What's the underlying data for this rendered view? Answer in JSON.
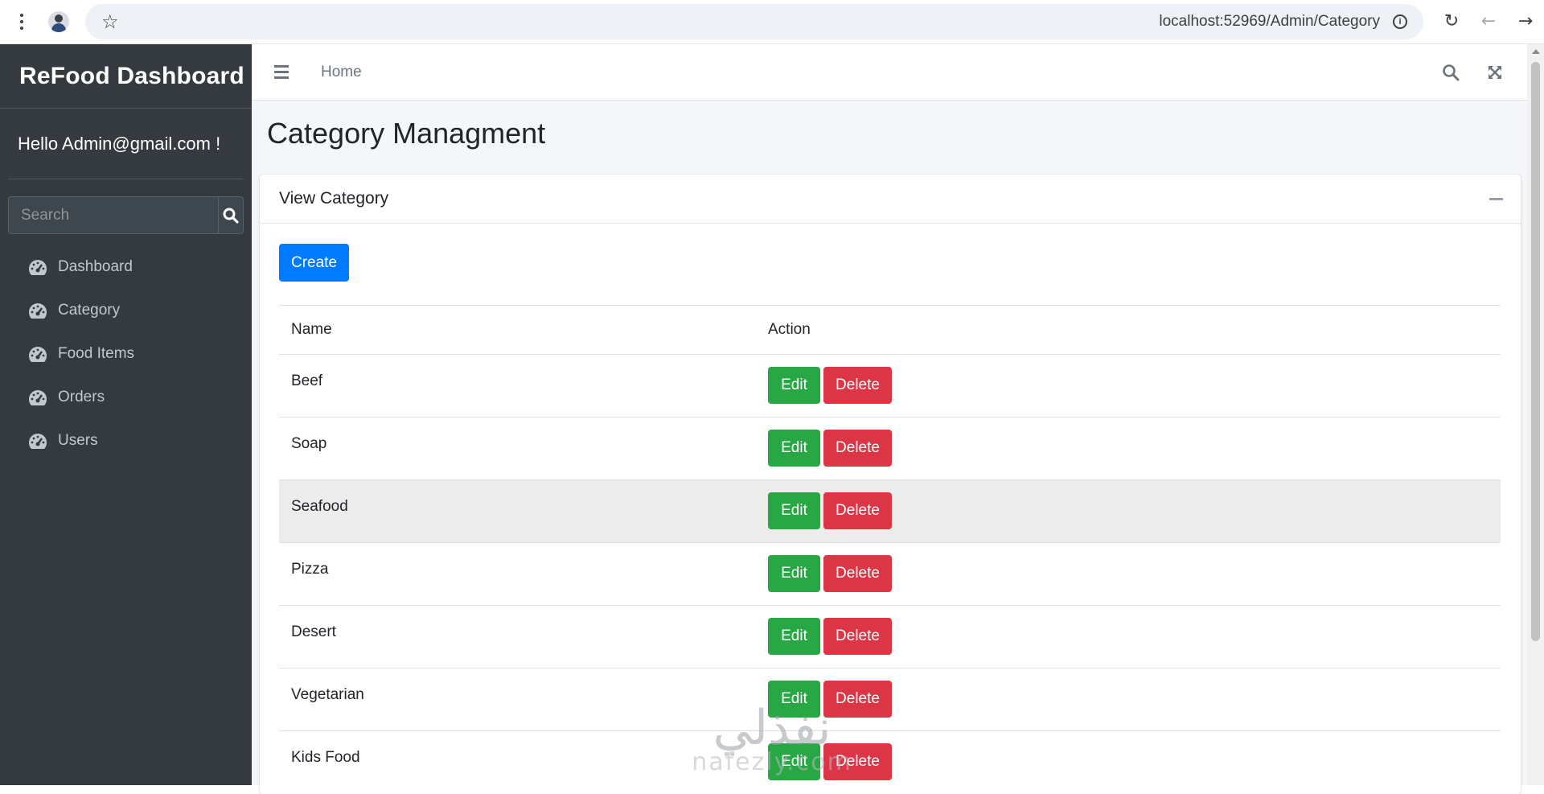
{
  "browser": {
    "url": "localhost:52969/Admin/Category",
    "icons": [
      "menu-kebab-icon",
      "profile-avatar",
      "bookmark-star-icon",
      "site-info-icon",
      "reload-icon",
      "back-arrow-icon",
      "forward-arrow-icon"
    ]
  },
  "sidebar": {
    "brand": "ReFood Dashboard",
    "greeting": "Hello Admin@gmail.com !",
    "search_placeholder": "Search",
    "items": [
      {
        "label": "Dashboard",
        "icon": "gauge-icon"
      },
      {
        "label": "Category",
        "icon": "gauge-icon"
      },
      {
        "label": "Food Items",
        "icon": "gauge-icon"
      },
      {
        "label": "Orders",
        "icon": "gauge-icon"
      },
      {
        "label": "Users",
        "icon": "gauge-icon"
      }
    ]
  },
  "topbar": {
    "home": "Home",
    "icons": [
      "hamburger-menu-icon",
      "search-icon",
      "fullscreen-icon"
    ]
  },
  "page": {
    "title": "Category Managment",
    "card_title": "View Category",
    "create_label": "Create",
    "table": {
      "headers": [
        "Name",
        "Action"
      ],
      "edit_label": "Edit",
      "delete_label": "Delete",
      "rows": [
        "Beef",
        "Soap",
        "Seafood",
        "Pizza",
        "Desert",
        "Vegetarian",
        "Kids Food"
      ],
      "highlighted_row": "Seafood"
    }
  },
  "colors": {
    "sidebar_bg": "#343a40",
    "primary": "#007bff",
    "success": "#28a745",
    "danger": "#dc3545",
    "content_bg": "#f4f6f9"
  },
  "watermark": {
    "arabic": "نفذلي",
    "latin": "nafezly.com"
  }
}
